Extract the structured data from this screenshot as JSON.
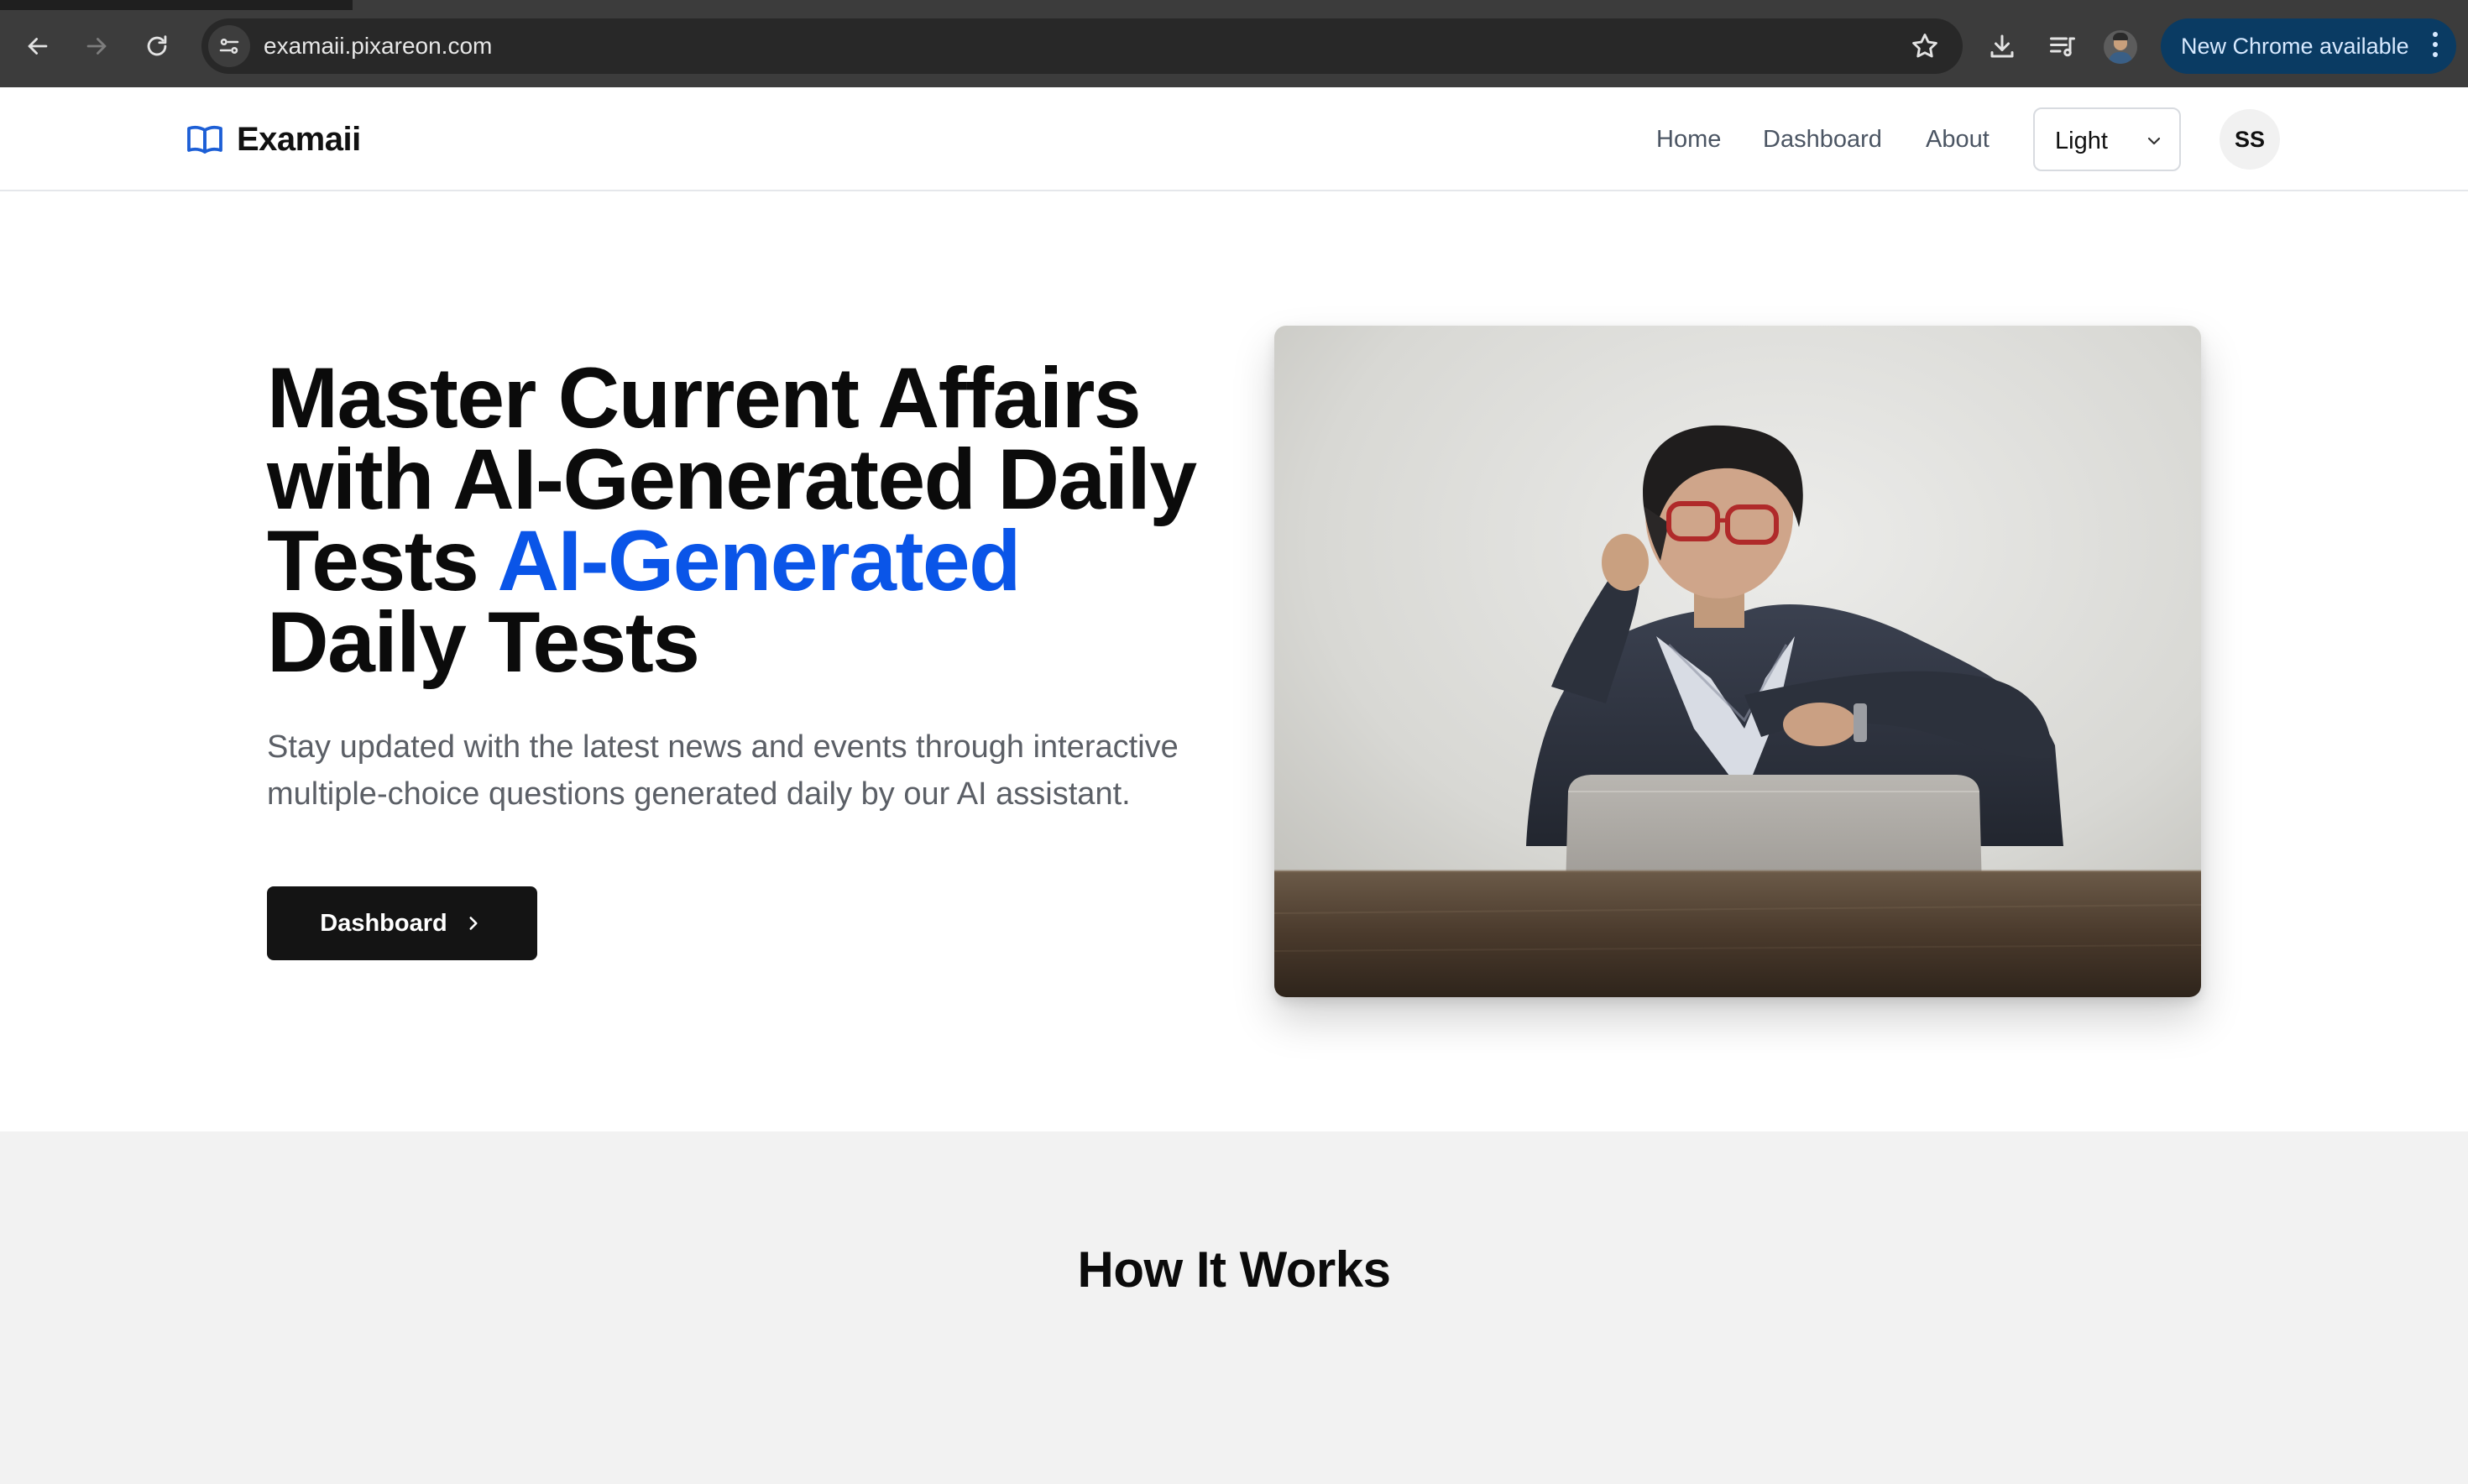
{
  "browser": {
    "url": "examaii.pixareon.com",
    "update_label": "New Chrome available",
    "icons": {
      "back": "arrow-left-icon",
      "forward": "arrow-right-icon",
      "reload": "reload-icon",
      "site_info": "tune-icon",
      "bookmark": "star-icon",
      "download": "download-icon",
      "media": "media-queue-icon",
      "menu": "kebab-menu-icon"
    }
  },
  "header": {
    "brand": "Examaii",
    "brand_icon": "open-book-icon",
    "nav": [
      {
        "label": "Home"
      },
      {
        "label": "Dashboard"
      },
      {
        "label": "About"
      }
    ],
    "theme_select": {
      "value": "Light"
    },
    "avatar_initials": "SS"
  },
  "hero": {
    "title_main": "Master Current Affairs with AI-Generated Daily Tests",
    "title_accent": "AI-Generated",
    "title_tail": "Daily Tests",
    "subtitle": "Stay updated with the latest news and events through interactive multiple-choice questions generated daily by our AI assistant.",
    "cta_label": "Dashboard",
    "image_description_icon": "hero-photo"
  },
  "how_it_works": {
    "title": "How It Works"
  },
  "colors": {
    "accent": "#0a55e8",
    "cta_bg": "#141414",
    "chrome_bg": "#3c3c3c",
    "update_pill": "#0a3b63",
    "section_bg": "#f2f2f2"
  }
}
